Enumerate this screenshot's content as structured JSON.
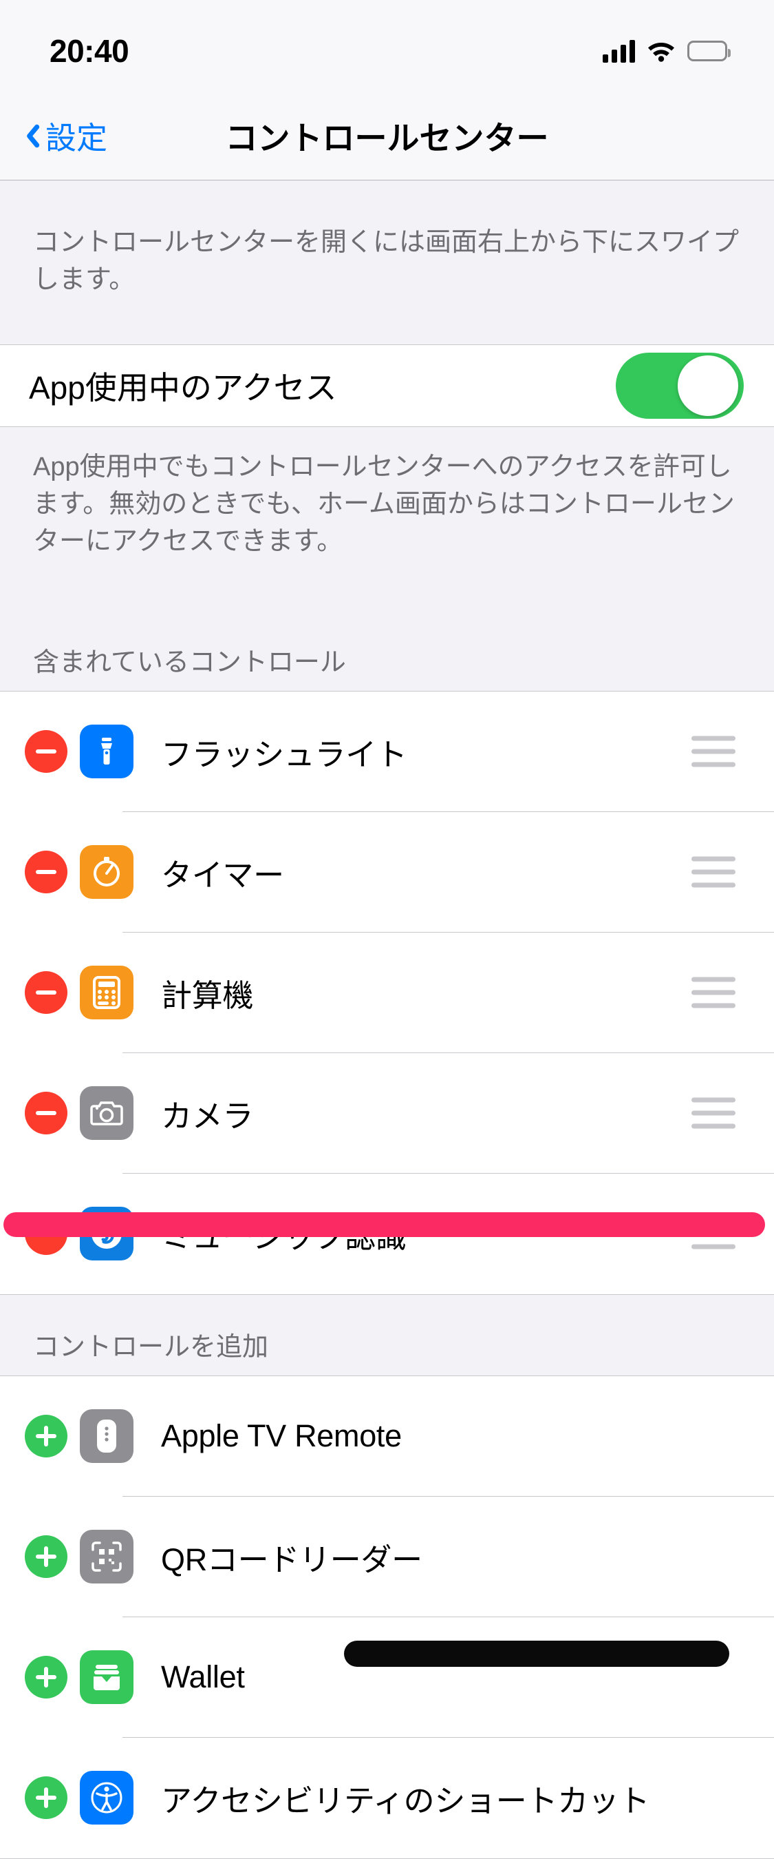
{
  "status_bar": {
    "time": "20:40",
    "signal_icon": "cellular-signal-icon",
    "wifi_icon": "wifi-icon",
    "battery_icon": "battery-full-icon"
  },
  "nav": {
    "back_label": "設定",
    "back_icon": "chevron-left-icon",
    "title": "コントロールセンター"
  },
  "intro_text": "コントロールセンターを開くには画面右上から下にスワイプします。",
  "access_row": {
    "label": "App使用中のアクセス",
    "toggle_state": "on",
    "toggle_color": "#34C759"
  },
  "access_footer": "App使用中でもコントロールセンターへのアクセスを許可します。無効のときでも、ホーム画面からはコントロールセンターにアクセスできます。",
  "included_section": {
    "header": "含まれているコントロール",
    "items": [
      {
        "label": "フラッシュライト",
        "icon": "flashlight-icon",
        "icon_color": "#007AFF",
        "action_icon": "remove-minus-icon",
        "handle_icon": "drag-handle-icon"
      },
      {
        "label": "タイマー",
        "icon": "timer-icon",
        "icon_color": "#F7971C",
        "action_icon": "remove-minus-icon",
        "handle_icon": "drag-handle-icon"
      },
      {
        "label": "計算機",
        "icon": "calculator-icon",
        "icon_color": "#F7971C",
        "action_icon": "remove-minus-icon",
        "handle_icon": "drag-handle-icon"
      },
      {
        "label": "カメラ",
        "icon": "camera-icon",
        "icon_color": "#8E8E93",
        "action_icon": "remove-minus-icon",
        "handle_icon": "drag-handle-icon"
      },
      {
        "label": "ミュージック認識",
        "icon": "music-recognition-icon",
        "icon_color": "#0E7FE1",
        "action_icon": "remove-minus-icon",
        "handle_icon": "drag-handle-icon"
      }
    ]
  },
  "add_section": {
    "header": "コントロールを追加",
    "items": [
      {
        "label": "Apple TV Remote",
        "icon": "apple-tv-remote-icon",
        "icon_color": "#8E8E93",
        "action_icon": "add-plus-icon"
      },
      {
        "label": "QRコードリーダー",
        "icon": "qr-code-reader-icon",
        "icon_color": "#8E8E93",
        "action_icon": "add-plus-icon"
      },
      {
        "label": "Wallet",
        "icon": "wallet-icon",
        "icon_color": "#35C759",
        "action_icon": "add-plus-icon"
      },
      {
        "label": "アクセシビリティのショートカット",
        "icon": "accessibility-icon",
        "icon_color": "#007AFF",
        "action_icon": "add-plus-icon"
      }
    ]
  },
  "annotations": {
    "pink_stroke_color": "#FC2A62",
    "black_stroke_color": "#0A0A0A"
  }
}
